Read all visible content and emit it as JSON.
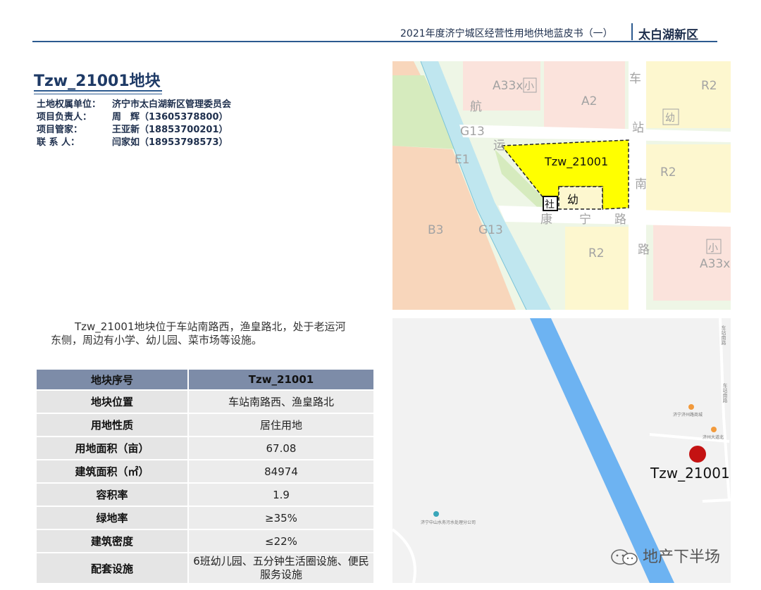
{
  "header": {
    "title": "2021年度济宁城区经营性用地供地蓝皮书（一）",
    "district": "太白湖新区"
  },
  "parcel": {
    "title": "Tzw_21001地块",
    "contacts": [
      {
        "label": "土地权属单位：",
        "value": "济宁市太白湖新区管理委员会"
      },
      {
        "label": "项目负责人：",
        "value": "周　辉（13605378800）"
      },
      {
        "label": "项目管家：",
        "value": "王亚新（18853700201）"
      },
      {
        "label": "联 系 人：",
        "value": "闫家如（18953798573）"
      }
    ],
    "description": "Tzw_21001地块位于车站南路西，渔皇路北，处于老运河东侧，周边有小学、幼儿园、菜市场等设施。"
  },
  "table": {
    "header": {
      "label": "地块序号",
      "value": "Tzw_21001"
    },
    "rows": [
      {
        "label": "地块位置",
        "value": "车站南路西、渔皇路北"
      },
      {
        "label": "用地性质",
        "value": "居住用地"
      },
      {
        "label": "用地面积（亩）",
        "value": "67.08"
      },
      {
        "label": "建筑面积（㎡）",
        "value": "84974"
      },
      {
        "label": "容积率",
        "value": "1.9"
      },
      {
        "label": "绿地率",
        "value": "≥35%"
      },
      {
        "label": "建筑密度",
        "value": "≤22%"
      },
      {
        "label": "配套设施",
        "value": "6班幼儿园、五分钟生活圈设施、便民服务设施"
      }
    ]
  },
  "planning_map": {
    "zones": [
      "A33x",
      "小",
      "A2",
      "R2",
      "幼",
      "G13",
      "E1",
      "R2",
      "B3",
      "G13",
      "R2",
      "小",
      "A33x"
    ],
    "roads": [
      "车",
      "站",
      "南",
      "路",
      "航",
      "运",
      "康",
      "宁",
      "路"
    ],
    "parcel_label": "Tzw_21001",
    "facility_she": "社",
    "facility_you": "幼",
    "colors": {
      "parcel": "#ffff00",
      "residential": "#fdf7cf",
      "commercial": "#f8d6bb",
      "public": "#fbe3dc",
      "green": "#d6ebbe",
      "water": "#bfe6ef"
    }
  },
  "location_map": {
    "marker_label": "Tzw_21001",
    "poi_labels": [
      "济宁济州路商城",
      "济州大道北",
      "济宁中山水务污水处理分公司"
    ],
    "road_labels": [
      "车站南路",
      "车站南路"
    ],
    "colors": {
      "river": "#6db3f2",
      "marker": "#c41212"
    }
  },
  "watermark": {
    "icon": "wechat-icon",
    "text": "地产下半场"
  }
}
